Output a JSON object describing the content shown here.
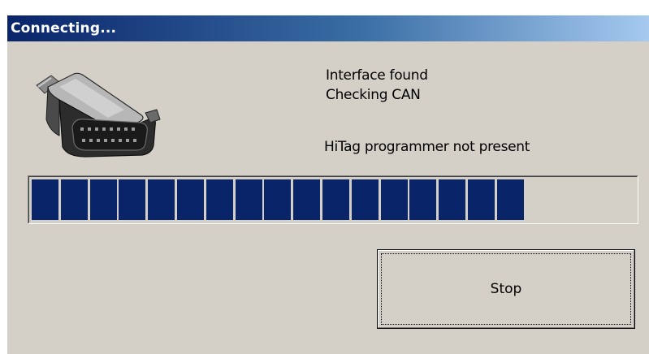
{
  "window": {
    "title": "Connecting..."
  },
  "status": {
    "line1": "Interface found",
    "line2": "Checking CAN",
    "line3": "HiTag programmer not present"
  },
  "progress": {
    "filled_blocks": 17,
    "total_blocks": 21,
    "fraction": 0.81,
    "fill_color": "#0a246a"
  },
  "buttons": {
    "stop_label": "Stop"
  },
  "icons": {
    "connector": "obd2-connector-icon"
  },
  "colors": {
    "face": "#d4d0c8",
    "title_start": "#0a246a",
    "title_end": "#a6caf0"
  }
}
